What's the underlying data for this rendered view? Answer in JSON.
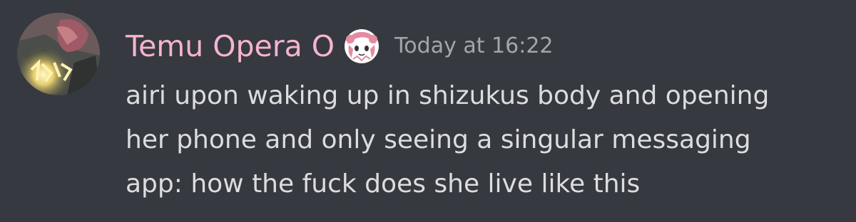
{
  "message": {
    "author": "Temu Opera O",
    "timestamp": "Today at 16:22",
    "content_lines": [
      "airi upon waking up in shizukus body and opening",
      "her phone and only seeing a singular messaging",
      "app: how the fuck does she live like this"
    ]
  },
  "icons": {
    "avatar": "user-avatar",
    "role_icon": "pink-haired-character-role-icon"
  },
  "colors": {
    "background": "#36393f",
    "username": "#f5b3d1",
    "timestamp": "#a3a6aa",
    "text": "#dcddde"
  }
}
